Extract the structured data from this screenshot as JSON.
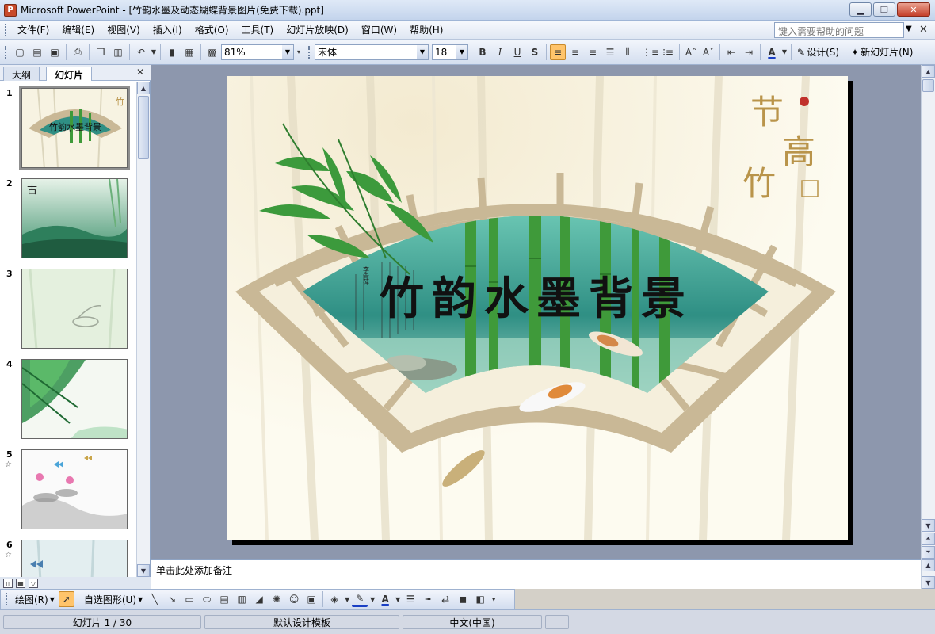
{
  "window": {
    "title": "Microsoft PowerPoint - [竹韵水墨及动态蝴蝶背景图片(免费下载).ppt]",
    "minimize": "▁",
    "maximize": "❐",
    "close": "✕"
  },
  "menu": {
    "items": [
      "文件(F)",
      "编辑(E)",
      "视图(V)",
      "插入(I)",
      "格式(O)",
      "工具(T)",
      "幻灯片放映(D)",
      "窗口(W)",
      "帮助(H)"
    ],
    "help_placeholder": "键入需要帮助的问题"
  },
  "toolbar": {
    "zoom": "81%",
    "font": "宋体",
    "font_size": "18",
    "bold": "B",
    "italic": "I",
    "underline": "U",
    "shadow": "S",
    "design_label": "设计(S)",
    "new_slide_label": "新幻灯片(N)"
  },
  "left_pane": {
    "tab_outline": "大纲",
    "tab_slides": "幻灯片",
    "close": "✕",
    "slides": [
      {
        "num": "1",
        "star": "",
        "selected": true
      },
      {
        "num": "2",
        "star": ""
      },
      {
        "num": "3",
        "star": ""
      },
      {
        "num": "4",
        "star": ""
      },
      {
        "num": "5",
        "star": "☆"
      },
      {
        "num": "6",
        "star": "☆"
      }
    ]
  },
  "slide": {
    "title": "竹韵水墨背景",
    "seal_line1": "节",
    "seal_line2": "高",
    "seal_line3": "竹",
    "poem_author": "李青莲"
  },
  "notes": {
    "placeholder": "单击此处添加备注"
  },
  "drawbar": {
    "draw_label": "绘图(R)",
    "autoshapes_label": "自选图形(U)"
  },
  "status": {
    "slide_counter": "幻灯片 1 / 30",
    "template": "默认设计模板",
    "language": "中文(中国)"
  },
  "colors": {
    "frame": "#c9b896",
    "teal": "#2f8f84",
    "bamboo": "#3f9a3a",
    "slide_bg": "#fdfbf0"
  }
}
